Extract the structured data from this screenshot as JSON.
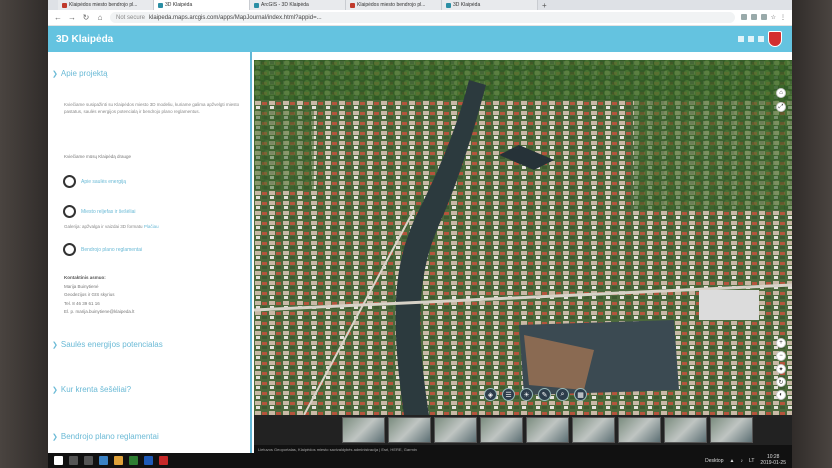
{
  "browser": {
    "tabs": [
      {
        "label": "Klaipėdos miesto bendrojo pl...",
        "icon": "app-icon"
      },
      {
        "label": "3D Klaipėda",
        "icon": "arcgis-icon"
      },
      {
        "label": "ArcGIS - 3D Klaipėda",
        "icon": "arcgis-icon"
      },
      {
        "label": "Klaipėdos miesto bendrojo pl...",
        "icon": "city-crest-icon"
      },
      {
        "label": "3D Klaipėda",
        "icon": "arcgis-icon"
      }
    ],
    "security_label": "Not secure",
    "url": "klaipeda.maps.arcgis.com/apps/MapJournal/index.html?appid=..."
  },
  "app": {
    "title": "3D Klaipėda"
  },
  "side": {
    "section_about": "Apie projektą",
    "intro": "Kviečiame susipažinti su Klaipėdos miesto 3D modeliu, kuriame galima apžvelgti miesto pastatus, saulės energijos potencialą ir bendrojo plano reglamentus.",
    "invite": "Kviečiame mūsų Klaipėdą drauge",
    "items": [
      {
        "label": "Apie saulės energiją"
      },
      {
        "label": "Miesto reljefas ir šešėliai"
      },
      {
        "label": "Bendrojo plano reglamentai"
      }
    ],
    "item2_sub": "Galerija: apžvalga ir vaizdai 3D formatu",
    "item2_sub_link": "Plačiau",
    "contacts_heading": "Kontaktinis asmuo:",
    "contacts": [
      "Marija Buinytienė",
      "Geodezijos ir GIS skyrius",
      "Tel. 8 46 39 61 16",
      "El. p. marija.buinytiene@klaipeda.lt"
    ],
    "section_solar": "Saulės energijos potencialas",
    "section_shadow": "Kur krenta šešėliai?",
    "section_plan": "Bendrojo plano reglamentai"
  },
  "map": {
    "credits": "Lietuvos Geoportalas, Klaipėdos miesto savivaldybės administracija | Esri, HERE, Garmin"
  },
  "taskbar": {
    "desktop_label": "Desktop",
    "lang": "LT",
    "time": "10:28",
    "date": "2019-01-25"
  },
  "colors": {
    "accent": "#64c3e0",
    "link": "#6bbad6"
  }
}
